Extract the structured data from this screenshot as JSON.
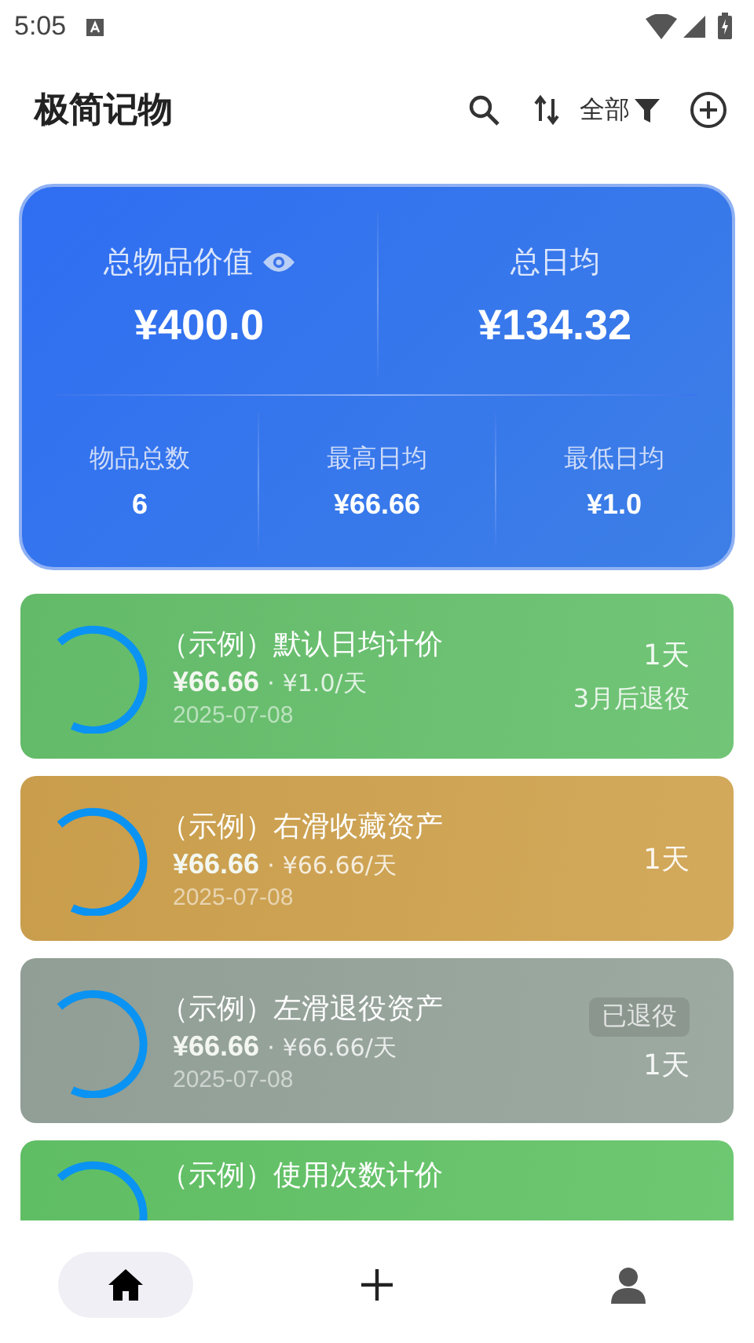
{
  "status_bar": {
    "time": "5:05"
  },
  "header": {
    "title": "极简记物",
    "filter_label": "全部"
  },
  "summary": {
    "top": [
      {
        "label": "总物品价值",
        "value": "¥400.0",
        "eye": true
      },
      {
        "label": "总日均",
        "value": "¥134.32",
        "eye": false
      }
    ],
    "bottom": [
      {
        "label": "物品总数",
        "value": "6"
      },
      {
        "label": "最高日均",
        "value": "¥66.66"
      },
      {
        "label": "最低日均",
        "value": "¥1.0"
      }
    ]
  },
  "items": [
    {
      "title": "（示例）默认日均计价",
      "price": "¥66.66",
      "sep": "·",
      "daily": "¥1.0/天",
      "date": "2025-07-08",
      "days": "1天",
      "note": "3月后退役",
      "color": "#66c06c"
    },
    {
      "title": "（示例）右滑收藏资产",
      "price": "¥66.66",
      "sep": "·",
      "daily": "¥66.66/天",
      "date": "2025-07-08",
      "days": "1天",
      "color": "#cfa24e"
    },
    {
      "title": "（示例）左滑退役资产",
      "price": "¥66.66",
      "sep": "·",
      "daily": "¥66.66/天",
      "date": "2025-07-08",
      "days": "1天",
      "badge": "已退役",
      "color": "#95a39a"
    },
    {
      "title": "（示例）使用次数计价",
      "color": "#62c366"
    }
  ],
  "nav": [
    {
      "kind": "home",
      "selected": true
    },
    {
      "kind": "add",
      "selected": false
    },
    {
      "kind": "profile",
      "selected": false
    }
  ]
}
